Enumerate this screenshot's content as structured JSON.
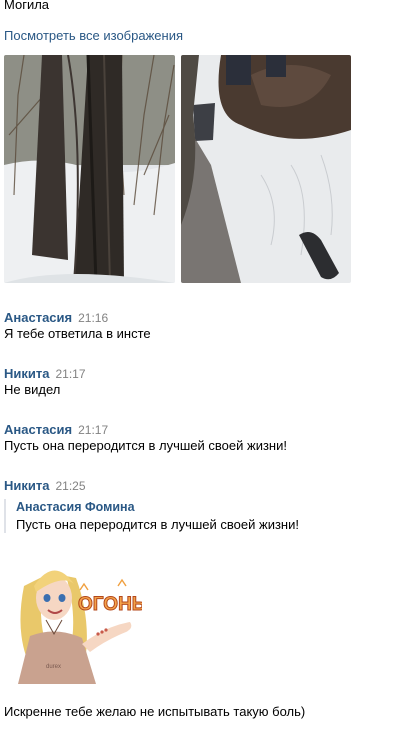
{
  "top_caption": "Могила",
  "view_all_link": "Посмотреть все изображения",
  "photos": [
    "photo-forest-trees",
    "photo-snow-boot"
  ],
  "messages": [
    {
      "author": "Анастасия",
      "time": "21:16",
      "text": "Я тебе ответила в инсте"
    },
    {
      "author": "Никита",
      "time": "21:17",
      "text": "Не видел"
    },
    {
      "author": "Анастасия",
      "time": "21:17",
      "text": "Пусть она переродится в лучшей своей жизни!"
    },
    {
      "author": "Никита",
      "time": "21:25",
      "quote": {
        "author": "Анастасия Фомина",
        "text": "Пусть она переродится в лучшей своей жизни!"
      },
      "sticker": {
        "word": "ОГОНЬ",
        "shirt": "durex"
      },
      "text": "Искренне тебе желаю не испытывать такую боль)"
    }
  ],
  "colors": {
    "author": "#2a5885",
    "time": "#828282",
    "quote_border": "#dfe2e8"
  }
}
